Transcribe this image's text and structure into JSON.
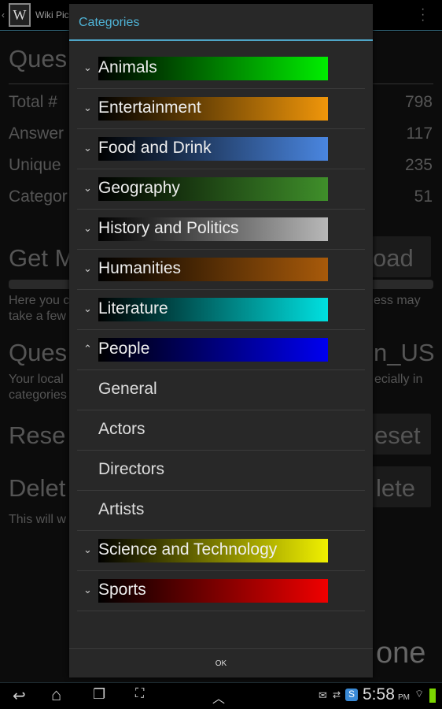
{
  "app": {
    "title": "Wiki Pic",
    "menu_icon": "overflow-menu-icon"
  },
  "background": {
    "questions_heading": "Ques",
    "stats": [
      {
        "label": "Total #",
        "value": "798"
      },
      {
        "label": "Answer",
        "value": "117"
      },
      {
        "label": "Unique",
        "value": "235"
      },
      {
        "label": "Categor",
        "value": "51"
      }
    ],
    "get_more": "Get M",
    "download_button": "oad",
    "download_desc_left": "Here you c",
    "download_desc_left2": "take a few",
    "download_desc_right": "ess may",
    "locale_heading": "Ques",
    "locale_value": "n_US",
    "locale_desc_left": "Your local",
    "locale_desc_left2": "categories",
    "locale_desc_right": "ecially in",
    "reset_heading": "Rese",
    "reset_button": "eset",
    "delete_heading": "Delet",
    "delete_button": "lete",
    "delete_desc": "This will w",
    "done_button": "one"
  },
  "dialog": {
    "title": "Categories",
    "categories": [
      {
        "label": "Animals",
        "color": "#00ee00",
        "expanded": false
      },
      {
        "label": "Entertainment",
        "color": "#f0960a",
        "expanded": false
      },
      {
        "label": "Food and Drink",
        "color": "#4a86e0",
        "expanded": false
      },
      {
        "label": "Geography",
        "color": "#3f8f2a",
        "expanded": false
      },
      {
        "label": "History and Politics",
        "color": "#b8b8b8",
        "expanded": false
      },
      {
        "label": "Humanities",
        "color": "#a85a0a",
        "expanded": false
      },
      {
        "label": "Literature",
        "color": "#00e0e0",
        "expanded": false
      },
      {
        "label": "People",
        "color": "#0000f0",
        "expanded": true,
        "children": [
          "General",
          "Actors",
          "Directors",
          "Artists"
        ]
      },
      {
        "label": "Science and Technology",
        "color": "#f0f000",
        "expanded": false
      },
      {
        "label": "Sports",
        "color": "#f00000",
        "expanded": false
      }
    ],
    "ok_label": "OK"
  },
  "status_bar": {
    "time": "5:58",
    "ampm": "PM"
  }
}
